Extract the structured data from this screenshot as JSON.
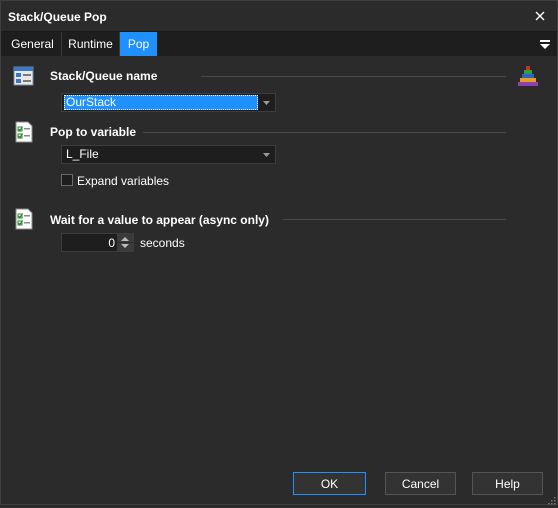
{
  "window": {
    "title": "Stack/Queue Pop"
  },
  "tabs": [
    {
      "label": "General",
      "active": false
    },
    {
      "label": "Runtime",
      "active": false
    },
    {
      "label": "Pop",
      "active": true
    }
  ],
  "sections": {
    "stack_name": {
      "label": "Stack/Queue name",
      "value": "OurStack",
      "icon": "stack-settings-icon"
    },
    "pop_variable": {
      "label": "Pop to variable",
      "value": "L_File",
      "icon": "checklist-document-icon",
      "expand_variables": {
        "label": "Expand variables",
        "checked": false
      }
    },
    "wait": {
      "label": "Wait for a value to appear (async only)",
      "value": "0",
      "unit": "seconds",
      "icon": "checklist-document-icon"
    }
  },
  "buttons": {
    "ok": "OK",
    "cancel": "Cancel",
    "help": "Help"
  },
  "colors": {
    "background": "#2b2b2b",
    "accent": "#1e90ff",
    "input_background": "#1e1e1e",
    "rule": "#4a4a4a"
  }
}
